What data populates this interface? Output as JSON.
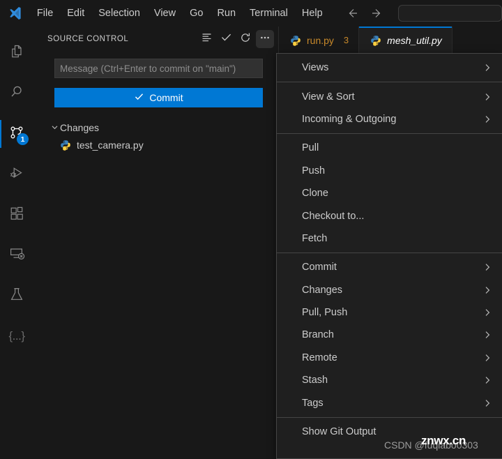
{
  "titlebar": {
    "logo_icon": "vscode-logo-icon",
    "menus": [
      "File",
      "Edit",
      "Selection",
      "View",
      "Go",
      "Run",
      "Terminal",
      "Help"
    ],
    "back_icon": "arrow-left-icon",
    "forward_icon": "arrow-right-icon",
    "command_center_value": ""
  },
  "activitybar": {
    "items": [
      {
        "name": "explorer",
        "icon": "files-icon",
        "active": false,
        "badge": ""
      },
      {
        "name": "search",
        "icon": "search-icon",
        "active": false,
        "badge": ""
      },
      {
        "name": "source-control",
        "icon": "source-control-icon",
        "active": true,
        "badge": "1"
      },
      {
        "name": "run-and-debug",
        "icon": "run-debug-icon",
        "active": false,
        "badge": ""
      },
      {
        "name": "extensions",
        "icon": "extensions-icon",
        "active": false,
        "badge": ""
      },
      {
        "name": "remote-explorer",
        "icon": "remote-explorer-icon",
        "active": false,
        "badge": ""
      },
      {
        "name": "testing",
        "icon": "beaker-icon",
        "active": false,
        "badge": ""
      },
      {
        "name": "json-braces",
        "icon": "braces-icon",
        "active": false,
        "badge": ""
      }
    ],
    "braces_glyph": "{...}"
  },
  "sidebar": {
    "title": "SOURCE CONTROL",
    "actions": [
      {
        "name": "view-as-list",
        "icon": "list-icon"
      },
      {
        "name": "commit-check",
        "icon": "check-icon"
      },
      {
        "name": "refresh",
        "icon": "refresh-icon"
      },
      {
        "name": "more-actions",
        "icon": "ellipsis-icon"
      }
    ],
    "commit_input_placeholder": "Message (Ctrl+Enter to commit on \"main\")",
    "commit_button_label": "Commit",
    "commit_button_icon": "check-icon",
    "changes_group_label": "Changes",
    "changes_chevron": "chevron-down-icon",
    "files": [
      {
        "name": "test_camera.py",
        "icon": "python-file-icon"
      }
    ]
  },
  "tabs": [
    {
      "label": "run.py",
      "icon": "python-file-icon",
      "badge": "3",
      "modified": true,
      "active": false,
      "preview": false
    },
    {
      "label": "mesh_util.py",
      "icon": "python-file-icon",
      "badge": "",
      "modified": false,
      "active": true,
      "preview": true
    }
  ],
  "context_menu": {
    "groups": [
      {
        "items": [
          {
            "label": "Views",
            "submenu": true
          }
        ]
      },
      {
        "items": [
          {
            "label": "View & Sort",
            "submenu": true
          },
          {
            "label": "Incoming & Outgoing",
            "submenu": true
          }
        ]
      },
      {
        "items": [
          {
            "label": "Pull",
            "submenu": false
          },
          {
            "label": "Push",
            "submenu": false
          },
          {
            "label": "Clone",
            "submenu": false
          },
          {
            "label": "Checkout to...",
            "submenu": false
          },
          {
            "label": "Fetch",
            "submenu": false
          }
        ]
      },
      {
        "items": [
          {
            "label": "Commit",
            "submenu": true
          },
          {
            "label": "Changes",
            "submenu": true
          },
          {
            "label": "Pull, Push",
            "submenu": true
          },
          {
            "label": "Branch",
            "submenu": true
          },
          {
            "label": "Remote",
            "submenu": true
          },
          {
            "label": "Stash",
            "submenu": true
          },
          {
            "label": "Tags",
            "submenu": true
          }
        ]
      },
      {
        "items": [
          {
            "label": "Show Git Output",
            "submenu": false
          }
        ]
      }
    ],
    "submenu_icon": "chevron-right-icon"
  },
  "watermark": {
    "csdn_text": "CSDN @fuqiabo0303",
    "site_text": "znwx.cn"
  },
  "colors": {
    "accent": "#0078d4",
    "titlebar_bg": "#181818",
    "editor_bg": "#1f1f1f",
    "menu_bg": "#1f1f1f",
    "menu_border": "#454545",
    "modified_tab": "#c8892a",
    "text": "#cccccc"
  }
}
